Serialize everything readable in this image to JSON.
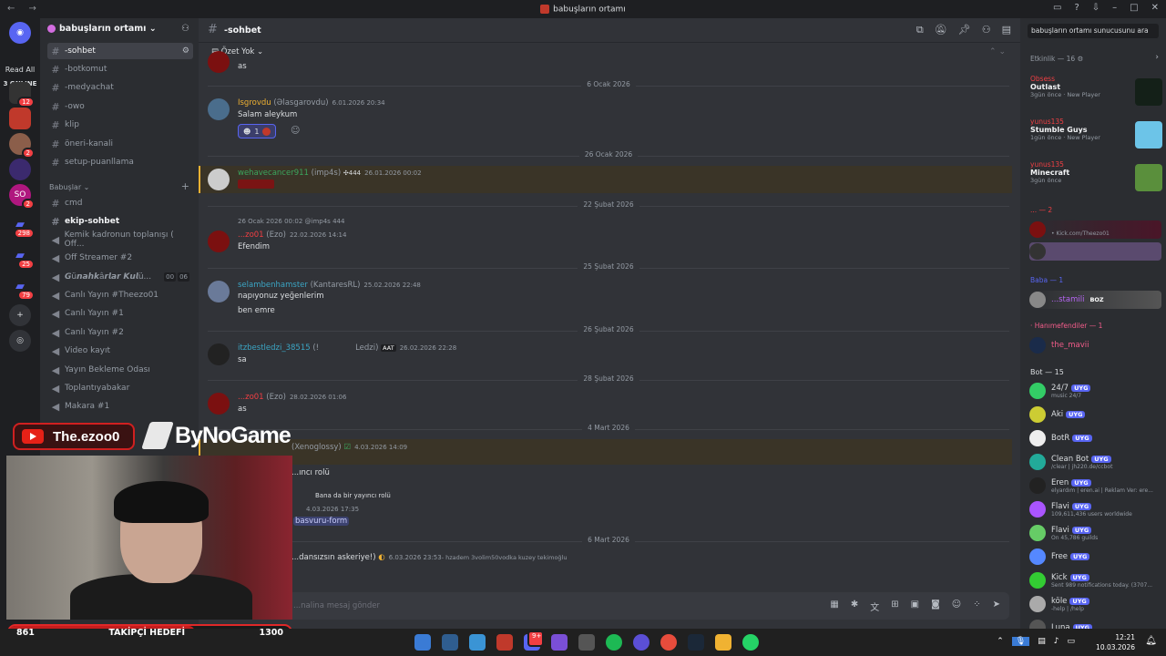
{
  "window": {
    "title": "babuşların ortamı"
  },
  "guild_bar": {
    "read_all": "Read All",
    "online": "3 ONLINE",
    "badges": [
      "12",
      "2",
      "2",
      "298",
      "25",
      "79"
    ]
  },
  "server": {
    "name": "babuşların ortamı"
  },
  "channels": [
    {
      "name": "-sohbet",
      "active": true
    },
    {
      "name": "-botkomut"
    },
    {
      "name": "-medyachat"
    },
    {
      "name": "-owo"
    },
    {
      "name": "klip"
    },
    {
      "name": "öneri-kanali"
    },
    {
      "name": "setup-puanllama"
    }
  ],
  "category": "Babuşlar",
  "channels2": [
    {
      "name": "cmd"
    },
    {
      "name": "ekip-sohbet",
      "bold": true
    },
    {
      "name": "Kemik kadronun toplanışı ( Off..."
    },
    {
      "name": "Off Streamer #2"
    },
    {
      "name": "𝙂ü𝙣𝙖𝙝𝙠â𝙧𝙡𝙖𝙧 𝙆𝙪𝙡ü..."
    },
    {
      "name": "Canlı Yayın #Theezo01"
    },
    {
      "name": "Canlı Yayın #1"
    },
    {
      "name": "Canlı Yayın #2"
    },
    {
      "name": "Video kayıt"
    },
    {
      "name": "Yayın Bekleme Odası"
    },
    {
      "name": "Toplantıyabakar"
    },
    {
      "name": "Makara #1"
    }
  ],
  "gunah_counts": [
    "00",
    "06"
  ],
  "channel_header": {
    "name": "-sohbet",
    "summary": "Özet Yok"
  },
  "messages": {
    "m0": {
      "text": "as"
    },
    "d1": "6 Ocak 2026",
    "m1": {
      "user": "Isgrovdu",
      "nick": "(Əlasgarovdu)",
      "time": "6.01.2026 20:34",
      "text": "Salam aleykum",
      "reaction_count": "1"
    },
    "d2": "26 Ocak 2026",
    "m2": {
      "user": "wehavecancer911",
      "nick": "(imp4s)",
      "badge": "444",
      "time": "26.01.2026 00:02"
    },
    "d3": "22 Şubat 2026",
    "m3": {
      "reply_time": "26 Ocak 2026 00:02",
      "reply_user": "@imp4s",
      "reply_badge": "444",
      "user": "...zo01",
      "nick": "(Ezo)",
      "time": "22.02.2026 14:14",
      "text": "Efendim"
    },
    "d4": "25 Şubat 2026",
    "m4": {
      "user": "selambenhamster",
      "nick": "(KantaresRL)",
      "time": "25.02.2026 22:48",
      "text": "napıyonuz yeğenlerim",
      "text2": "ben emre"
    },
    "d5": "26 Şubat 2026",
    "m5": {
      "user": "itzbestledzi_38515",
      "nick": "(!",
      "nick2": "Ledzi)",
      "badge": "AAT",
      "time": "26.02.2026 22:28",
      "text": "sa"
    },
    "d6": "28 Şubat 2026",
    "m6": {
      "user": "...zo01",
      "nick": "(Ezo)",
      "time": "28.02.2026 01:06",
      "text": "as"
    },
    "d7": "4 Mart 2026",
    "m7": {
      "nick": "(Xenoglossy)",
      "time": "4.03.2026 14:09",
      "text": "...ıncı rolü",
      "reply": "Bana da bir yayıncı rolü",
      "time2": "4.03.2026 17:35",
      "link": "basvuru-form"
    },
    "d8": "6 Mart 2026",
    "m8": {
      "text": "...dansızsın askeriye!)",
      "time": "6.03.2026 23:53",
      "extra": "- hzadem 3volim50vodka kuzey tekimoğlu"
    }
  },
  "input": {
    "placeholder": "...nalina mesaj gönder"
  },
  "search": {
    "placeholder": "babuşların ortamı sunucusunu ara"
  },
  "activity": {
    "header": "Etkinlik — 16",
    "items": [
      {
        "who": "Obsess",
        "game": "Outlast",
        "meta": "3gün önce · New Player"
      },
      {
        "who": "yunus135",
        "game": "Stumble Guys",
        "meta": "1gün önce · New Player"
      },
      {
        "who": "yunus135",
        "game": "Minecraft",
        "meta": "3gün önce"
      }
    ]
  },
  "members": {
    "group1": "... — 2",
    "m1_sub": "• Kick.com/Theezo01",
    "group2": "Baba — 1",
    "m2_name": "...stamili",
    "m2_tag": "BOZ",
    "group3": "· Hanımefendiler — 1",
    "m3_name": "the_mavii",
    "bots_header": "Bot — 15",
    "bots": [
      {
        "name": "24/7",
        "sub": "music 24/7"
      },
      {
        "name": "Aki",
        "sub": ""
      },
      {
        "name": "BotR",
        "sub": ""
      },
      {
        "name": "Clean Bot",
        "sub": "/clear | jh220.de/ccbot"
      },
      {
        "name": "Eren",
        "sub": "elyardım | eren.ai | Reklam Ver: ere..."
      },
      {
        "name": "Flavi",
        "sub": "109,611,436 users worldwide"
      },
      {
        "name": "Flavi",
        "sub": "On 45,786 guilds"
      },
      {
        "name": "Free",
        "sub": ""
      },
      {
        "name": "Kick",
        "sub": "Sent 989 notifications today. (3707..."
      },
      {
        "name": "köle",
        "sub": "-help | /help"
      },
      {
        "name": "Luna",
        "sub": ""
      }
    ],
    "bot_tag": "UYG"
  },
  "overlay": {
    "youtube": "The.ezoo0",
    "sponsor": "ByNoGame",
    "follow_label": "TAKİPÇİ HEDEFİ",
    "follow_current": "861",
    "follow_goal": "1300",
    "follow_fraction": 0.66
  },
  "taskbar": {
    "time": "12:21",
    "date": "10.03.2026",
    "discord_badge": "9+"
  },
  "colors": {
    "accent": "#5865f2",
    "highlight": "#f0b232",
    "alert": "#f23f43"
  }
}
